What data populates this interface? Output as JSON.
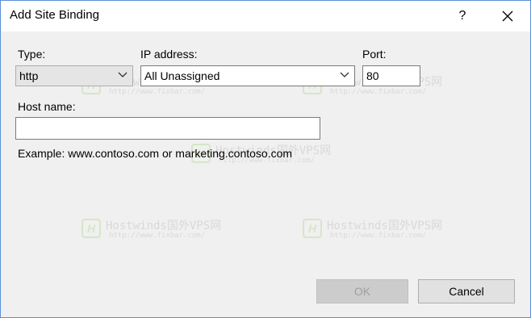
{
  "window": {
    "title": "Add Site Binding",
    "help_label": "?"
  },
  "form": {
    "type": {
      "label": "Type:",
      "value": "http"
    },
    "ip": {
      "label": "IP address:",
      "value": "All Unassigned"
    },
    "port": {
      "label": "Port:",
      "value": "80"
    },
    "host": {
      "label": "Host name:",
      "value": "",
      "example": "Example: www.contoso.com or marketing.contoso.com"
    }
  },
  "buttons": {
    "ok": "OK",
    "cancel": "Cancel"
  },
  "watermark": {
    "title": "Hostwinds国外VPS网",
    "url": "http://www.fixbar.com/",
    "logo": "H"
  },
  "icons": {
    "close": "close-icon",
    "chevron": "chevron-down-icon"
  }
}
